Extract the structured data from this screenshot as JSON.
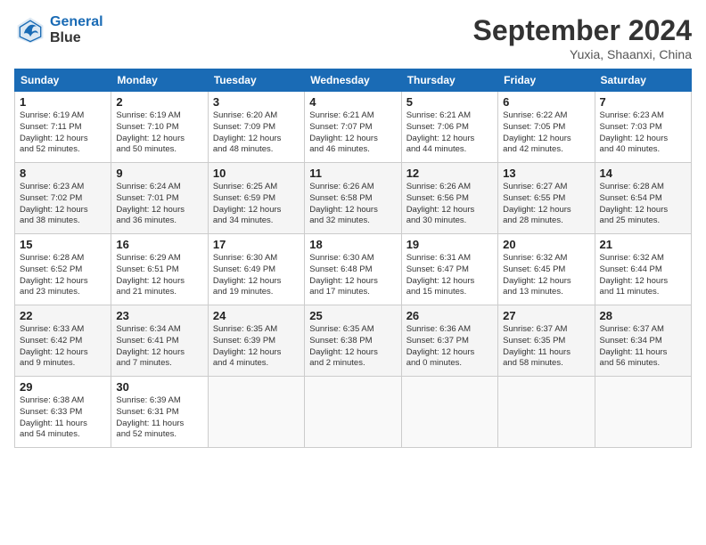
{
  "header": {
    "logo_line1": "General",
    "logo_line2": "Blue",
    "month": "September 2024",
    "location": "Yuxia, Shaanxi, China"
  },
  "weekdays": [
    "Sunday",
    "Monday",
    "Tuesday",
    "Wednesday",
    "Thursday",
    "Friday",
    "Saturday"
  ],
  "weeks": [
    [
      {
        "day": "1",
        "info": "Sunrise: 6:19 AM\nSunset: 7:11 PM\nDaylight: 12 hours\nand 52 minutes."
      },
      {
        "day": "2",
        "info": "Sunrise: 6:19 AM\nSunset: 7:10 PM\nDaylight: 12 hours\nand 50 minutes."
      },
      {
        "day": "3",
        "info": "Sunrise: 6:20 AM\nSunset: 7:09 PM\nDaylight: 12 hours\nand 48 minutes."
      },
      {
        "day": "4",
        "info": "Sunrise: 6:21 AM\nSunset: 7:07 PM\nDaylight: 12 hours\nand 46 minutes."
      },
      {
        "day": "5",
        "info": "Sunrise: 6:21 AM\nSunset: 7:06 PM\nDaylight: 12 hours\nand 44 minutes."
      },
      {
        "day": "6",
        "info": "Sunrise: 6:22 AM\nSunset: 7:05 PM\nDaylight: 12 hours\nand 42 minutes."
      },
      {
        "day": "7",
        "info": "Sunrise: 6:23 AM\nSunset: 7:03 PM\nDaylight: 12 hours\nand 40 minutes."
      }
    ],
    [
      {
        "day": "8",
        "info": "Sunrise: 6:23 AM\nSunset: 7:02 PM\nDaylight: 12 hours\nand 38 minutes."
      },
      {
        "day": "9",
        "info": "Sunrise: 6:24 AM\nSunset: 7:01 PM\nDaylight: 12 hours\nand 36 minutes."
      },
      {
        "day": "10",
        "info": "Sunrise: 6:25 AM\nSunset: 6:59 PM\nDaylight: 12 hours\nand 34 minutes."
      },
      {
        "day": "11",
        "info": "Sunrise: 6:26 AM\nSunset: 6:58 PM\nDaylight: 12 hours\nand 32 minutes."
      },
      {
        "day": "12",
        "info": "Sunrise: 6:26 AM\nSunset: 6:56 PM\nDaylight: 12 hours\nand 30 minutes."
      },
      {
        "day": "13",
        "info": "Sunrise: 6:27 AM\nSunset: 6:55 PM\nDaylight: 12 hours\nand 28 minutes."
      },
      {
        "day": "14",
        "info": "Sunrise: 6:28 AM\nSunset: 6:54 PM\nDaylight: 12 hours\nand 25 minutes."
      }
    ],
    [
      {
        "day": "15",
        "info": "Sunrise: 6:28 AM\nSunset: 6:52 PM\nDaylight: 12 hours\nand 23 minutes."
      },
      {
        "day": "16",
        "info": "Sunrise: 6:29 AM\nSunset: 6:51 PM\nDaylight: 12 hours\nand 21 minutes."
      },
      {
        "day": "17",
        "info": "Sunrise: 6:30 AM\nSunset: 6:49 PM\nDaylight: 12 hours\nand 19 minutes."
      },
      {
        "day": "18",
        "info": "Sunrise: 6:30 AM\nSunset: 6:48 PM\nDaylight: 12 hours\nand 17 minutes."
      },
      {
        "day": "19",
        "info": "Sunrise: 6:31 AM\nSunset: 6:47 PM\nDaylight: 12 hours\nand 15 minutes."
      },
      {
        "day": "20",
        "info": "Sunrise: 6:32 AM\nSunset: 6:45 PM\nDaylight: 12 hours\nand 13 minutes."
      },
      {
        "day": "21",
        "info": "Sunrise: 6:32 AM\nSunset: 6:44 PM\nDaylight: 12 hours\nand 11 minutes."
      }
    ],
    [
      {
        "day": "22",
        "info": "Sunrise: 6:33 AM\nSunset: 6:42 PM\nDaylight: 12 hours\nand 9 minutes."
      },
      {
        "day": "23",
        "info": "Sunrise: 6:34 AM\nSunset: 6:41 PM\nDaylight: 12 hours\nand 7 minutes."
      },
      {
        "day": "24",
        "info": "Sunrise: 6:35 AM\nSunset: 6:39 PM\nDaylight: 12 hours\nand 4 minutes."
      },
      {
        "day": "25",
        "info": "Sunrise: 6:35 AM\nSunset: 6:38 PM\nDaylight: 12 hours\nand 2 minutes."
      },
      {
        "day": "26",
        "info": "Sunrise: 6:36 AM\nSunset: 6:37 PM\nDaylight: 12 hours\nand 0 minutes."
      },
      {
        "day": "27",
        "info": "Sunrise: 6:37 AM\nSunset: 6:35 PM\nDaylight: 11 hours\nand 58 minutes."
      },
      {
        "day": "28",
        "info": "Sunrise: 6:37 AM\nSunset: 6:34 PM\nDaylight: 11 hours\nand 56 minutes."
      }
    ],
    [
      {
        "day": "29",
        "info": "Sunrise: 6:38 AM\nSunset: 6:33 PM\nDaylight: 11 hours\nand 54 minutes."
      },
      {
        "day": "30",
        "info": "Sunrise: 6:39 AM\nSunset: 6:31 PM\nDaylight: 11 hours\nand 52 minutes."
      },
      {
        "day": "",
        "info": ""
      },
      {
        "day": "",
        "info": ""
      },
      {
        "day": "",
        "info": ""
      },
      {
        "day": "",
        "info": ""
      },
      {
        "day": "",
        "info": ""
      }
    ]
  ]
}
